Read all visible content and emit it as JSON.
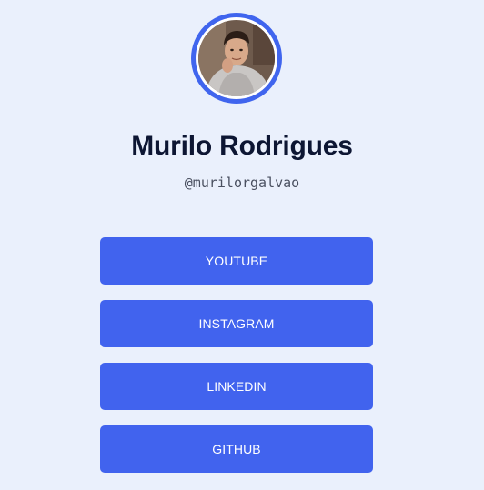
{
  "profile": {
    "name": "Murilo Rodrigues",
    "handle": "@murilorgalvao",
    "accent_color": "#4163ee",
    "background_color": "#eaf0fc"
  },
  "links": [
    {
      "label": "YOUTUBE"
    },
    {
      "label": "INSTAGRAM"
    },
    {
      "label": "LINKEDIN"
    },
    {
      "label": "GITHUB"
    }
  ]
}
